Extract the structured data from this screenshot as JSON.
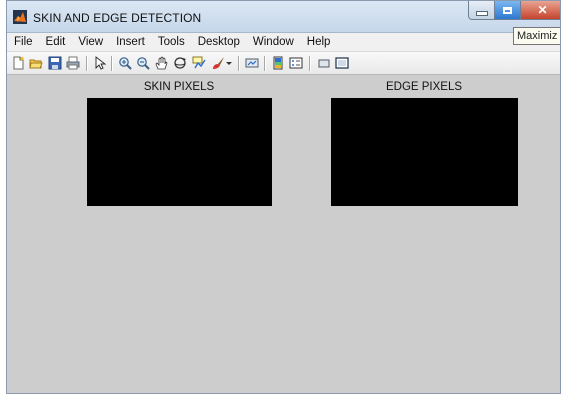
{
  "window": {
    "title": "SKIN AND EDGE DETECTION",
    "tooltip": "Maximiz",
    "close_glyph": "✕"
  },
  "menu": [
    "File",
    "Edit",
    "View",
    "Insert",
    "Tools",
    "Desktop",
    "Window",
    "Help"
  ],
  "toolbar": {
    "icons": [
      "new-figure-icon",
      "open-file-icon",
      "save-icon",
      "print-icon",
      "edit-plot-icon",
      "zoom-in-icon",
      "zoom-out-icon",
      "pan-icon",
      "rotate-3d-icon",
      "data-cursor-icon",
      "brush-icon",
      "dropdown-arrow-icon",
      "link-plot-icon",
      "colorbar-icon",
      "legend-icon",
      "hide-plot-tools-icon",
      "show-plot-tools-icon"
    ]
  },
  "panels": [
    {
      "title": "SKIN PIXELS",
      "image_color": "#000000"
    },
    {
      "title": "EDGE PIXELS",
      "image_color": "#000000"
    }
  ],
  "colors": {
    "figure_background": "#cdcdcd",
    "title_bar": "#c6d7ea",
    "close_button": "#c6442c"
  }
}
